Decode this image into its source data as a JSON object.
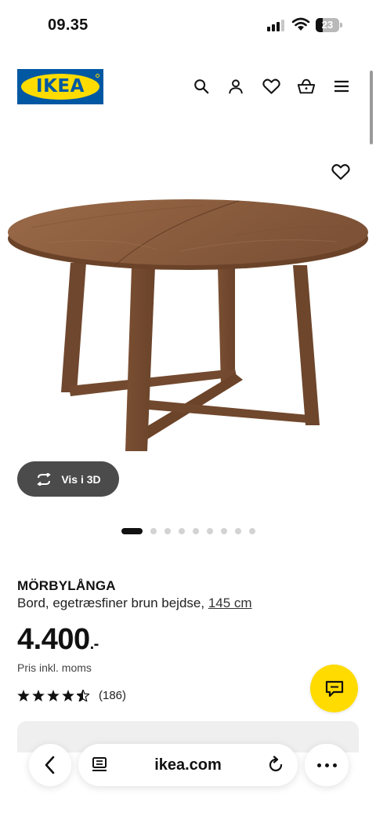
{
  "status_bar": {
    "time": "09.35",
    "battery_level": "23"
  },
  "header": {
    "logo_text": "IKEA",
    "icons": [
      "search-icon",
      "profile-icon",
      "favourites-icon",
      "basket-icon",
      "menu-icon"
    ]
  },
  "gallery": {
    "view_3d_label": "Vis i 3D",
    "image_count": 9,
    "active_index": 0
  },
  "product": {
    "name": "MÖRBYLÅNGA",
    "description": "Bord, egetræsfiner brun bejdse,",
    "size": "145 cm",
    "price_main": "4.400",
    "price_suffix": ".-",
    "price_note": "Pris inkl. moms",
    "rating_stars": 4.5,
    "rating_count": "(186)"
  },
  "browser": {
    "domain": "ikea.com"
  },
  "colors": {
    "ikea_blue": "#0058a3",
    "ikea_yellow": "#ffdb00",
    "wood": "#8a5a3b",
    "pill_dark": "#4b4b4b"
  }
}
